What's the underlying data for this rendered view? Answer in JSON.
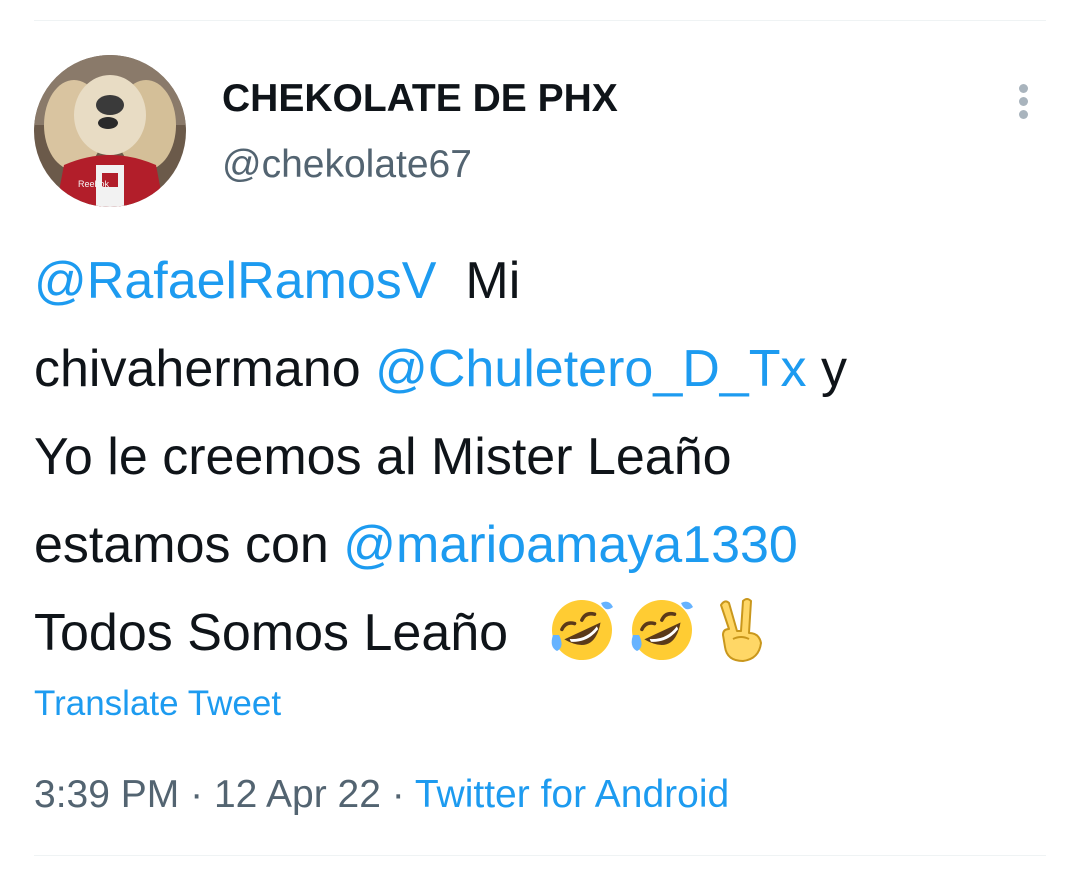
{
  "user": {
    "display_name": "CHEKOLATE DE PHX",
    "handle": "@chekolate67",
    "avatar_icon": "dog-avatar"
  },
  "tweet": {
    "mention_1": "@RafaelRamosV",
    "text_1": "Mi",
    "text_2": "chivahermano",
    "mention_2": "@Chuletero_D_Tx",
    "text_3": "y",
    "text_4": "Yo le creemos al Mister Leaño",
    "text_5": "estamos con",
    "mention_3": "@marioamaya1330",
    "text_6": "Todos Somos Leaño",
    "emojis": [
      "rolling-on-floor-laughing",
      "rolling-on-floor-laughing",
      "victory-hand"
    ]
  },
  "translate_label": "Translate Tweet",
  "meta": {
    "time": "3:39 PM",
    "separator": "·",
    "date": "12 Apr 22",
    "source": "Twitter for Android"
  },
  "colors": {
    "link": "#1d9bf0",
    "secondary": "#536471",
    "text": "#0f1419"
  }
}
